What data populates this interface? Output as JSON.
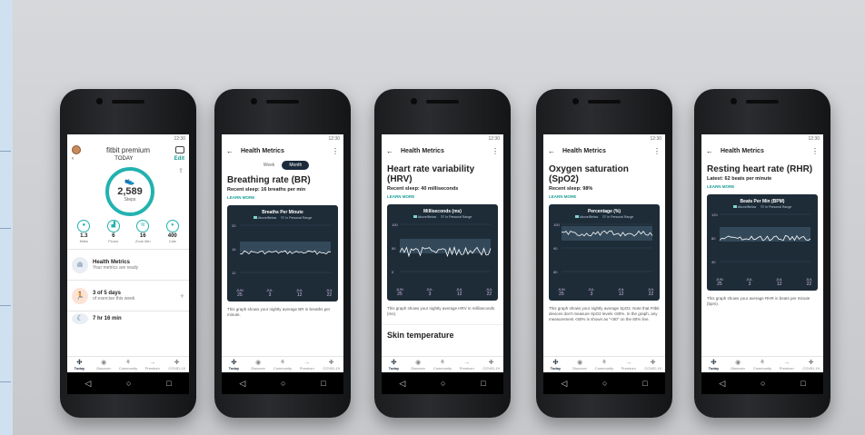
{
  "tabs": [
    "Today",
    "Discover",
    "Community",
    "Premium",
    "COVID-19"
  ],
  "nav": {
    "back": "◁",
    "home": "○",
    "recent": "□"
  },
  "status_time": "12:30",
  "phone1": {
    "brand": "fitbit premium",
    "today": "TODAY",
    "edit": "Edit",
    "steps": "2,589",
    "steps_label": "Steps",
    "stats": [
      {
        "value": "1.3",
        "label": "Miles",
        "icon": "pin-icon"
      },
      {
        "value": "6",
        "label": "Floors",
        "icon": "stairs-icon"
      },
      {
        "value": "16",
        "label": "Zone Min",
        "icon": "zone-icon"
      },
      {
        "value": "400",
        "label": "Cals",
        "icon": "flame-icon"
      }
    ],
    "card1_title": "Health Metrics",
    "card1_sub": "Your metrics are ready",
    "card2_title": "3 of 5 days",
    "card2_sub": "of exercise this week",
    "card3_title": "7 hr 16 min"
  },
  "phone2": {
    "header": "Health Metrics",
    "toggle_week": "Week",
    "toggle_month": "Month",
    "title": "Breathing rate (BR)",
    "sub": "Recent sleep: 16 breaths per min",
    "learn": "LEARN MORE",
    "chart_title": "Breaths Per Minute",
    "legend_a": "Above/Below",
    "legend_b": "In Personal Range",
    "y_ticks": [
      "20",
      "16",
      "12"
    ],
    "desc": "This graph shows your nightly average BR in breaths per minute."
  },
  "phone3": {
    "header": "Health Metrics",
    "title": "Heart rate variability (HRV)",
    "sub": "Recent sleep: 40 milliseconds",
    "learn": "LEARN MORE",
    "chart_title": "Milliseconds (ms)",
    "legend_a": "Above/Below",
    "legend_b": "In Personal Range",
    "y_ticks": [
      "100",
      "50",
      "0"
    ],
    "desc": "This graph shows your nightly average HRV in milliseconds (ms).",
    "section": "Skin temperature"
  },
  "phone4": {
    "header": "Health Metrics",
    "title": "Oxygen saturation (SpO2)",
    "sub": "Recent sleep: 98%",
    "learn": "LEARN MORE",
    "chart_title": "Percentage (%)",
    "legend_a": "Above/Below",
    "legend_b": "In Personal Range",
    "y_ticks": [
      "100",
      "90",
      "80"
    ],
    "desc": "This graph shows your nightly average SpO2. Note that Fitbit devices don't measure SpO2 levels <80%. In the graph, any measurement <80% is shown as \"<80\" on the 80% line."
  },
  "phone5": {
    "header": "Health Metrics",
    "title": "Resting heart rate (RHR)",
    "sub": "Latest: 62 beats per minute",
    "learn": "LEARN MORE",
    "chart_title": "Beats Per Min (BPM)",
    "legend_a": "Above/Below",
    "legend_b": "In Personal Range",
    "y_ticks": [
      "120",
      "80",
      "40"
    ],
    "desc": "This graph shows your average RHR in beats per minute (bpm)."
  },
  "x_axis": [
    {
      "m": "JUN",
      "d": "25"
    },
    {
      "m": "JUL",
      "d": "3"
    },
    {
      "m": "JUL",
      "d": "12"
    },
    {
      "m": "JUL",
      "d": "22"
    }
  ]
}
